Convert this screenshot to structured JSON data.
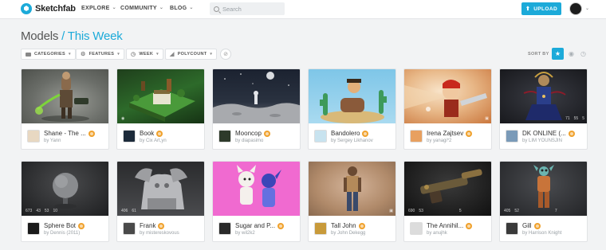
{
  "header": {
    "brand": "Sketchfab",
    "nav": [
      "EXPLORE",
      "COMMUNITY",
      "BLOG"
    ],
    "search_placeholder": "Search",
    "upload_label": "UPLOAD"
  },
  "title": {
    "main": "Models",
    "separator": " / ",
    "sub": "This Week"
  },
  "filters": [
    "CATEGORIES",
    "FEATURES",
    "WEEK",
    "POLYCOUNT"
  ],
  "sort": {
    "label": "SORT BY"
  },
  "cards": [
    {
      "title": "Shane - The ...",
      "author": "Yann"
    },
    {
      "title": "Book",
      "author": "Cix Art,yn"
    },
    {
      "title": "Mooncop",
      "author": "diapasimo"
    },
    {
      "title": "Bandolero",
      "author": "Sergey Likhanov"
    },
    {
      "title": "Irena Zajtsev",
      "author": "yanagi*2"
    },
    {
      "title": "DK ONLINE (...",
      "author": "LIM YOUNSJIN"
    },
    {
      "title": "Sphere Bot",
      "author": "Dennis (2011)",
      "stats": [
        "673",
        "43",
        "53",
        "10"
      ]
    },
    {
      "title": "Frank",
      "author": "mistereskovous",
      "stats": [
        "406",
        "61"
      ]
    },
    {
      "title": "Sugar and P...",
      "author": "wil2k2"
    },
    {
      "title": "Tall John",
      "author": "John Dekegg"
    },
    {
      "title": "The Annihil...",
      "author": "anujhk",
      "stats": [
        "690",
        "53",
        "5"
      ]
    },
    {
      "title": "Gill",
      "author": "Harrison Knight",
      "stats": [
        "405",
        "52",
        "7"
      ]
    }
  ],
  "first_row_stats": {
    "card5": [
      "71",
      "55",
      "5"
    ]
  }
}
